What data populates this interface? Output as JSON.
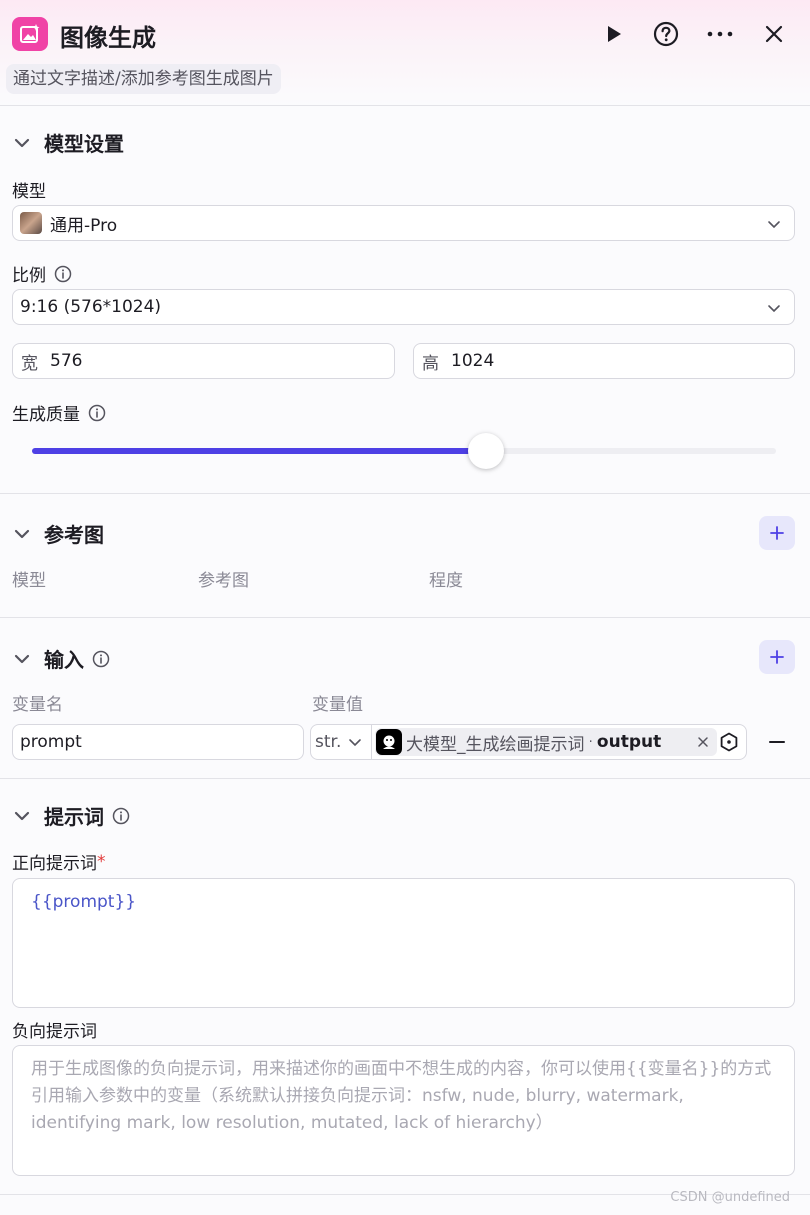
{
  "header": {
    "title": "图像生成",
    "subtitle": "通过文字描述/添加参考图生成图片",
    "logo_color": "#f043a6"
  },
  "model_settings": {
    "section_title": "模型设置",
    "model_label": "模型",
    "model_value": "通用-Pro",
    "ratio_label": "比例",
    "ratio_value": "9:16 (576*1024)",
    "width_prefix": "宽",
    "width_value": "576",
    "height_prefix": "高",
    "height_value": "1024",
    "quality_label": "生成质量",
    "quality_fraction": 0.61
  },
  "reference": {
    "section_title": "参考图",
    "columns": [
      "模型",
      "参考图",
      "程度"
    ]
  },
  "inputs": {
    "section_title": "输入",
    "col_name": "变量名",
    "col_value": "变量值",
    "rows": [
      {
        "name": "prompt",
        "type": "str.",
        "source_node": "大模型_生成绘画提示词",
        "source_sep": " · ",
        "source_field": "output"
      }
    ]
  },
  "prompt": {
    "section_title": "提示词",
    "positive_label": "正向提示词",
    "required_mark": "*",
    "positive_value": "{{prompt}}",
    "negative_label": "负向提示词",
    "negative_placeholder": "用于生成图像的负向提示词，用来描述你的画面中不想生成的内容，你可以使用{{变量名}}的方式引用输入参数中的变量（系统默认拼接负向提示词：nsfw, nude, blurry, watermark, identifying mark, low resolution, mutated, lack of hierarchy）"
  },
  "watermark": "CSDN @undefined",
  "colors": {
    "accent": "#4e40e5",
    "add_button_bg": "#e7e7fb",
    "variable_text": "#4a55c8",
    "required": "#e23a3a"
  }
}
